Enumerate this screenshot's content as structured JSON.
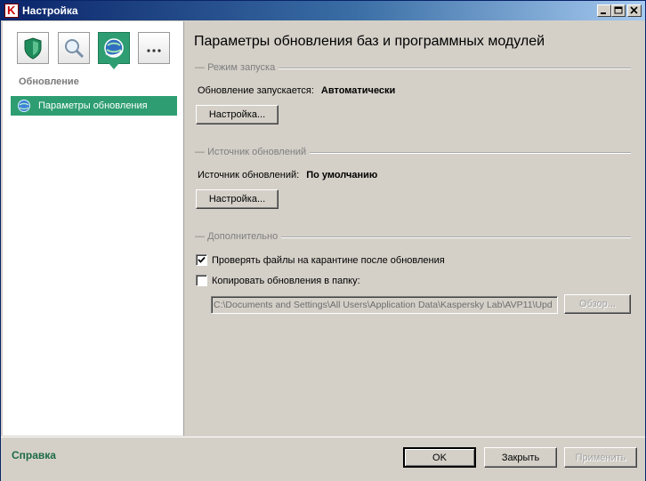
{
  "window": {
    "title": "Настройка"
  },
  "sidebar": {
    "categories": [
      {
        "icon": "shield-icon",
        "active": false
      },
      {
        "icon": "magnifier-icon",
        "active": false
      },
      {
        "icon": "globe-update-icon",
        "active": true
      },
      {
        "icon": "more-icon",
        "label": "...",
        "active": false
      }
    ],
    "section_title": "Обновление",
    "items": [
      {
        "label": "Параметры обновления",
        "icon": "globe-icon",
        "selected": true
      }
    ]
  },
  "main": {
    "heading": "Параметры обновления баз и программных модулей",
    "launch_group": {
      "label": "Режим запуска",
      "text": "Обновление запускается:",
      "value": "Автоматически",
      "button": "Настройка..."
    },
    "source_group": {
      "label": "Источник обновлений",
      "text": "Источник обновлений:",
      "value": "По умолчанию",
      "button": "Настройка..."
    },
    "extra_group": {
      "label": "Дополнительно",
      "check_quarantine": {
        "label": "Проверять файлы на карантине после обновления",
        "checked": true
      },
      "copy_updates": {
        "label": "Копировать обновления в папку:",
        "checked": false
      },
      "path_value": "C:\\Documents and Settings\\All Users\\Application Data\\Kaspersky Lab\\AVP11\\Upd",
      "browse_button": "Обзор..."
    }
  },
  "footer": {
    "help": "Справка",
    "ok": "OK",
    "close": "Закрыть",
    "apply": "Применить"
  },
  "colors": {
    "accent": "#2e9e72",
    "title_start": "#0a246a",
    "title_end": "#a6caf0",
    "help_link": "#1d6b45"
  }
}
